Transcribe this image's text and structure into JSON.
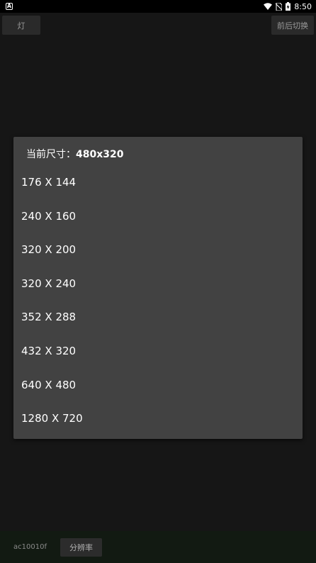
{
  "status_bar": {
    "notification_icon": "A",
    "time": "8:50",
    "icons": [
      "wifi-icon",
      "no-sim-icon",
      "battery-charging-icon"
    ]
  },
  "toolbar": {
    "light_label": "灯",
    "switch_camera_label": "前后切换"
  },
  "dialog": {
    "title_label": "当前尺寸：",
    "title_value": "480x320",
    "options": [
      "176 X 144",
      "240 X 160",
      "320 X 200",
      "320 X 240",
      "352 X 288",
      "432 X 320",
      "640 X 480",
      "1280 X 720"
    ]
  },
  "bottom": {
    "device_id": "ac10010f",
    "resolution_label": "分辨率"
  }
}
